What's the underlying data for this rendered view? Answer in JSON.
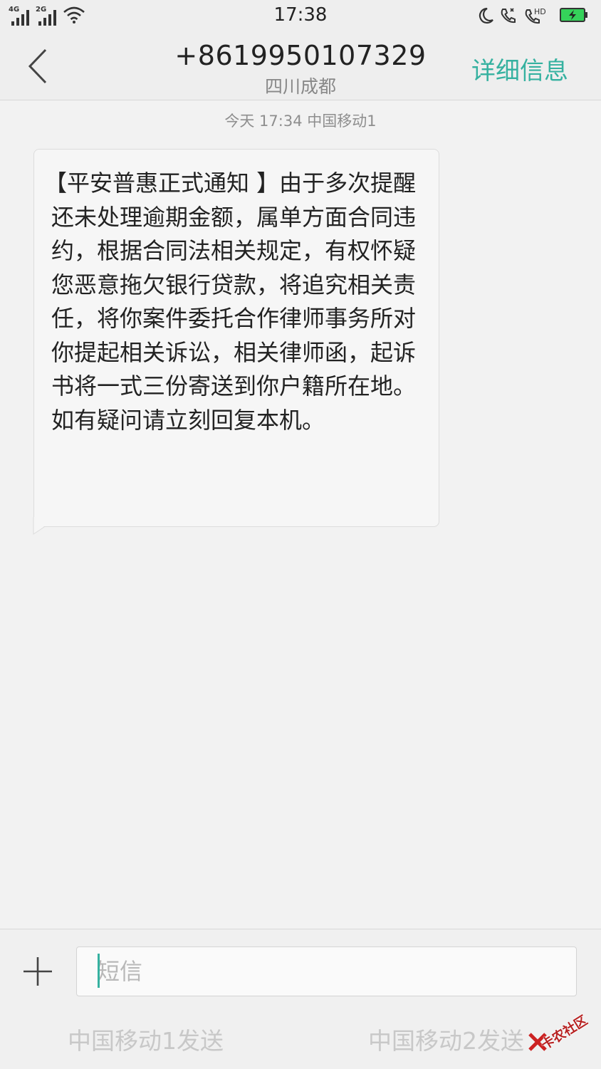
{
  "status_bar": {
    "time": "17:38",
    "signal_1_label": "4G",
    "signal_2_label": "2G",
    "hd_label": "HD",
    "icons": [
      "signal-icon",
      "wifi-icon",
      "moon-icon",
      "call-icon",
      "hd-call-icon",
      "battery-charging-icon"
    ]
  },
  "header": {
    "contact_number": "+8619950107329",
    "contact_location": "四川成都",
    "details_label": "详细信息"
  },
  "message": {
    "meta": "今天  17:34  中国移动1",
    "body": "【平安普惠正式通知 】由于多次提醒还未处理逾期金额，属单方面合同违约，根据合同法相关规定，有权怀疑您恶意拖欠银行贷款，将追究相关责任，将你案件委托合作律师事务所对你提起相关诉讼，相关律师函，起诉书将一式三份寄送到你户籍所在地。如有疑问请立刻回复本机。"
  },
  "composer": {
    "placeholder": "短信",
    "value": "",
    "send_sim1_label": "中国移动1发送",
    "send_sim2_label": "中国移动2发送"
  },
  "watermark": {
    "text": "卡农社区"
  },
  "colors": {
    "accent": "#35b1a0",
    "battery": "#35d25a"
  }
}
